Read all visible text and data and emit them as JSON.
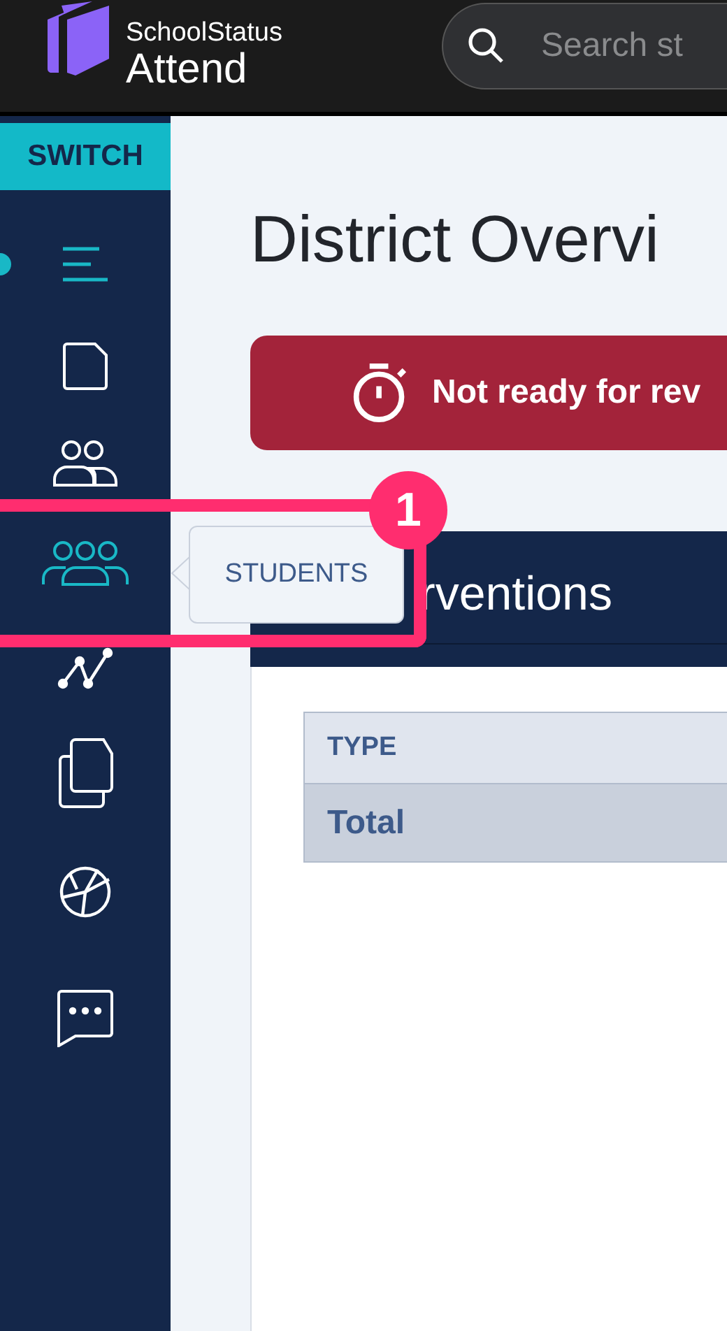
{
  "header": {
    "brand_top": "SchoolStatus",
    "brand_name": "Attend",
    "search": {
      "placeholder": "Search st"
    }
  },
  "sidebar": {
    "switch_label": "SWITCH",
    "items": [
      {
        "selected": false
      },
      {
        "selected": false
      },
      {
        "selected": true
      },
      {
        "selected": false
      },
      {
        "selected": false
      },
      {
        "selected": false
      },
      {
        "selected": false
      }
    ]
  },
  "tooltip": {
    "text": "STUDENTS"
  },
  "annotation": {
    "number": "1"
  },
  "main": {
    "title": "District Overvi",
    "alert": {
      "text": "Not ready for rev"
    },
    "panel_title": "rventions",
    "table": {
      "columns": [
        "TYPE"
      ],
      "rows": [
        [
          "Total"
        ]
      ]
    }
  }
}
